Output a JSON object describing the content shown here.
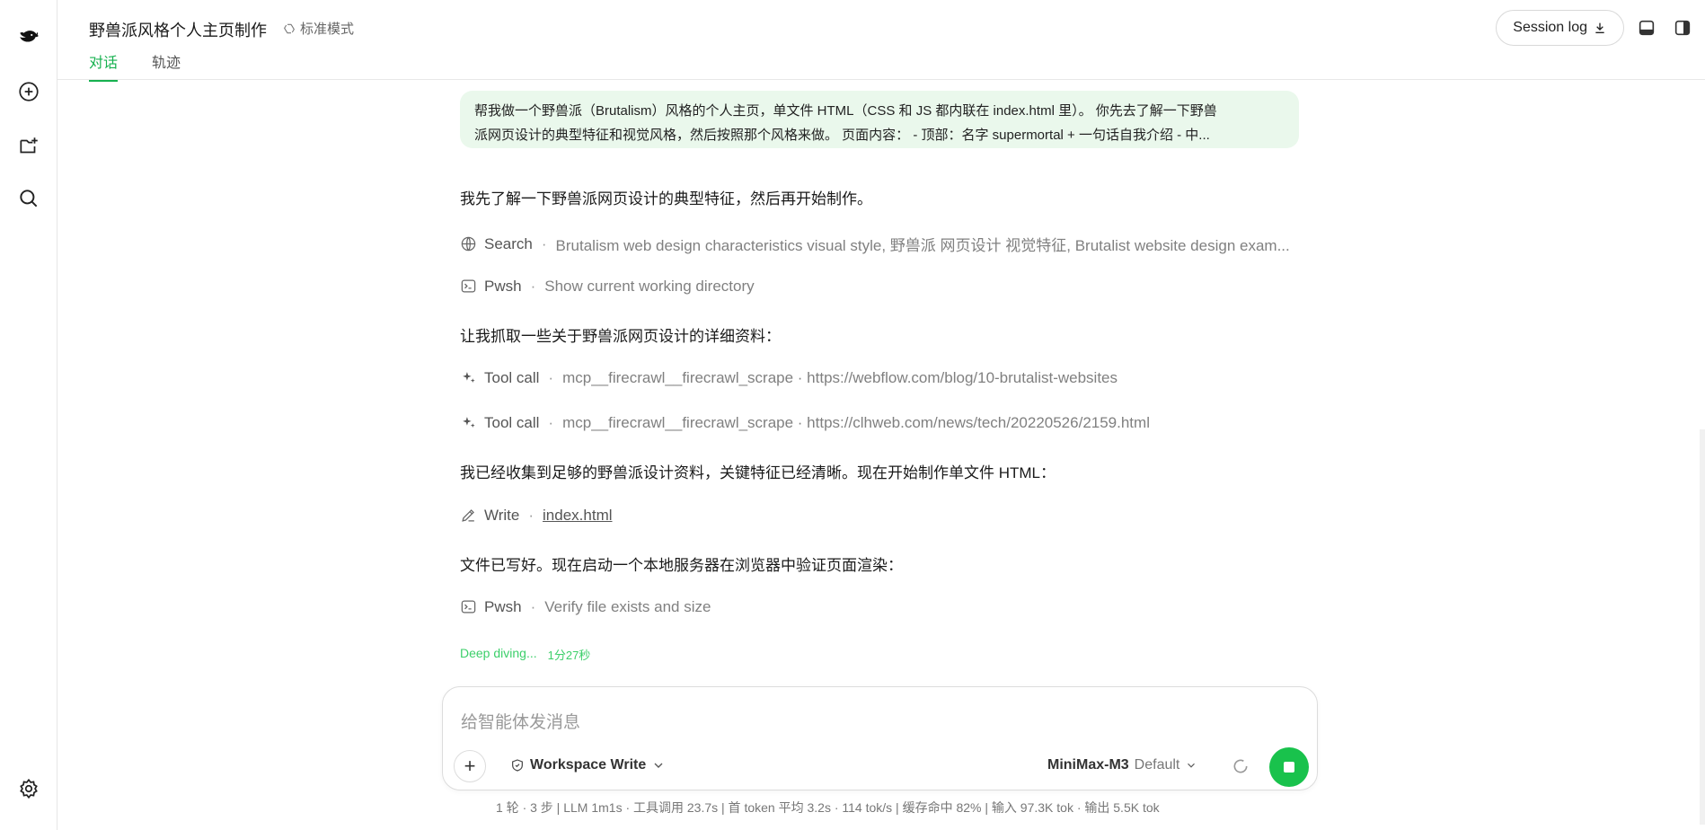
{
  "app": {
    "title": "野兽派风格个人主页制作",
    "mode_label": "标准模式",
    "tabs": [
      {
        "label": "对话",
        "active": true
      },
      {
        "label": "轨迹",
        "active": false
      }
    ],
    "session_log_label": "Session log",
    "accent_color": "#16b14f"
  },
  "rail": {
    "icons": [
      "whale-logo-icon",
      "new-chat-icon",
      "new-folder-icon",
      "search-icon",
      "settings-icon"
    ]
  },
  "conversation": {
    "user_message_line1": "帮我做一个野兽派（Brutalism）风格的个人主页，单文件 HTML（CSS 和 JS 都内联在 index.html 里）。 你先去了解一下野兽",
    "user_message_line2": "派网页设计的典型特征和视觉风格，然后按照那个风格来做。 页面内容： - 顶部：名字 supermortal + 一句话自我介绍 - 中...",
    "msg1": "我先了解一下野兽派网页设计的典型特征，然后再开始制作。",
    "step_search": {
      "name": "Search",
      "desc": "Brutalism web design characteristics visual style, 野兽派 网页设计 视觉特征, Brutalist website design exam..."
    },
    "step_pwsh1": {
      "name": "Pwsh",
      "desc": "Show current working directory"
    },
    "msg2": "让我抓取一些关于野兽派网页设计的详细资料：",
    "step_tool1": {
      "name": "Tool call",
      "desc": "mcp__firecrawl__firecrawl_scrape · https://webflow.com/blog/10-brutalist-websites"
    },
    "step_tool2": {
      "name": "Tool call",
      "desc": "mcp__firecrawl__firecrawl_scrape · https://clhweb.com/news/tech/20220526/2159.html"
    },
    "msg3": "我已经收集到足够的野兽派设计资料，关键特征已经清晰。现在开始制作单文件 HTML：",
    "step_write": {
      "name": "Write",
      "desc": "index.html"
    },
    "msg4": "文件已写好。现在启动一个本地服务器在浏览器中验证页面渲染：",
    "step_pwsh2": {
      "name": "Pwsh",
      "desc": "Verify file exists and size"
    },
    "status_text": "Deep diving...",
    "status_time": "1分27秒"
  },
  "composer": {
    "placeholder": "给智能体发消息",
    "workspace_label": "Workspace Write",
    "model_name": "MiniMax-M3",
    "model_variant": "Default"
  },
  "stats": {
    "text": "1 轮 · 3 步   |   LLM 1m1s · 工具调用 23.7s   |   首 token 平均 3.2s · 114 tok/s   |   缓存命中 82%   |   输入 97.3K tok · 输出 5.5K tok"
  }
}
